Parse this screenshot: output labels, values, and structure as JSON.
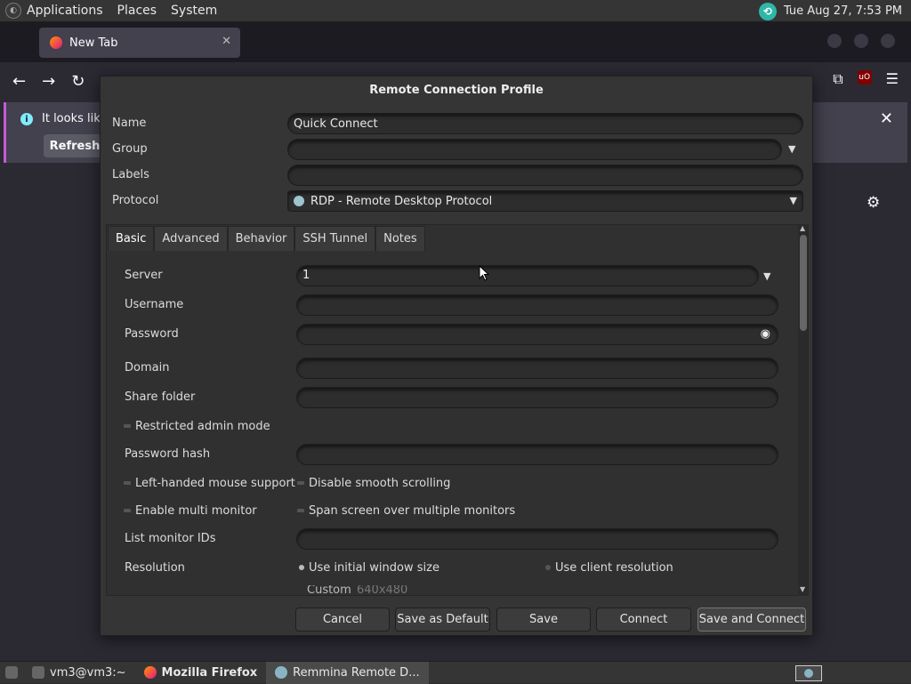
{
  "top_panel": {
    "menus": [
      "Applications",
      "Places",
      "System"
    ],
    "clock": "Tue Aug 27,  7:53 PM"
  },
  "firefox": {
    "tab_title": "New Tab",
    "notice_text": "It looks like",
    "refresh_label": "Refresh"
  },
  "dialog": {
    "title": "Remote Connection Profile",
    "name_label": "Name",
    "name_value": "Quick Connect",
    "group_label": "Group",
    "group_value": "",
    "labels_label": "Labels",
    "labels_value": "",
    "protocol_label": "Protocol",
    "protocol_value": "RDP - Remote Desktop Protocol",
    "tabs": [
      "Basic",
      "Advanced",
      "Behavior",
      "SSH Tunnel",
      "Notes"
    ],
    "active_tab": "Basic",
    "basic": {
      "server_label": "Server",
      "server_value": "1",
      "username_label": "Username",
      "password_label": "Password",
      "domain_label": "Domain",
      "share_folder_label": "Share folder",
      "restricted_admin_label": "Restricted admin mode",
      "password_hash_label": "Password hash",
      "left_handed_label": "Left-handed mouse support",
      "disable_smooth_label": "Disable smooth scrolling",
      "multi_monitor_label": "Enable multi monitor",
      "span_screen_label": "Span screen over multiple monitors",
      "list_monitor_label": "List monitor IDs",
      "resolution_label": "Resolution",
      "res_initial_label": "Use initial window size",
      "res_client_label": "Use client resolution",
      "res_custom_label": "Custom",
      "res_custom_value": "640x480",
      "resolution_selected": "Use initial window size"
    },
    "buttons": {
      "cancel": "Cancel",
      "save_default": "Save as Default",
      "save": "Save",
      "connect": "Connect",
      "save_connect": "Save and Connect"
    }
  },
  "taskbar": {
    "items": [
      "vm3@vm3:~",
      "Mozilla Firefox",
      "Remmina Remote D..."
    ]
  },
  "colors": {
    "dialog_bg": "#353535",
    "field_bg": "#2d2d2d",
    "panel_bg": "#353535",
    "firefox_bg": "#2b2a33",
    "notice_accent": "#c45bd8"
  }
}
